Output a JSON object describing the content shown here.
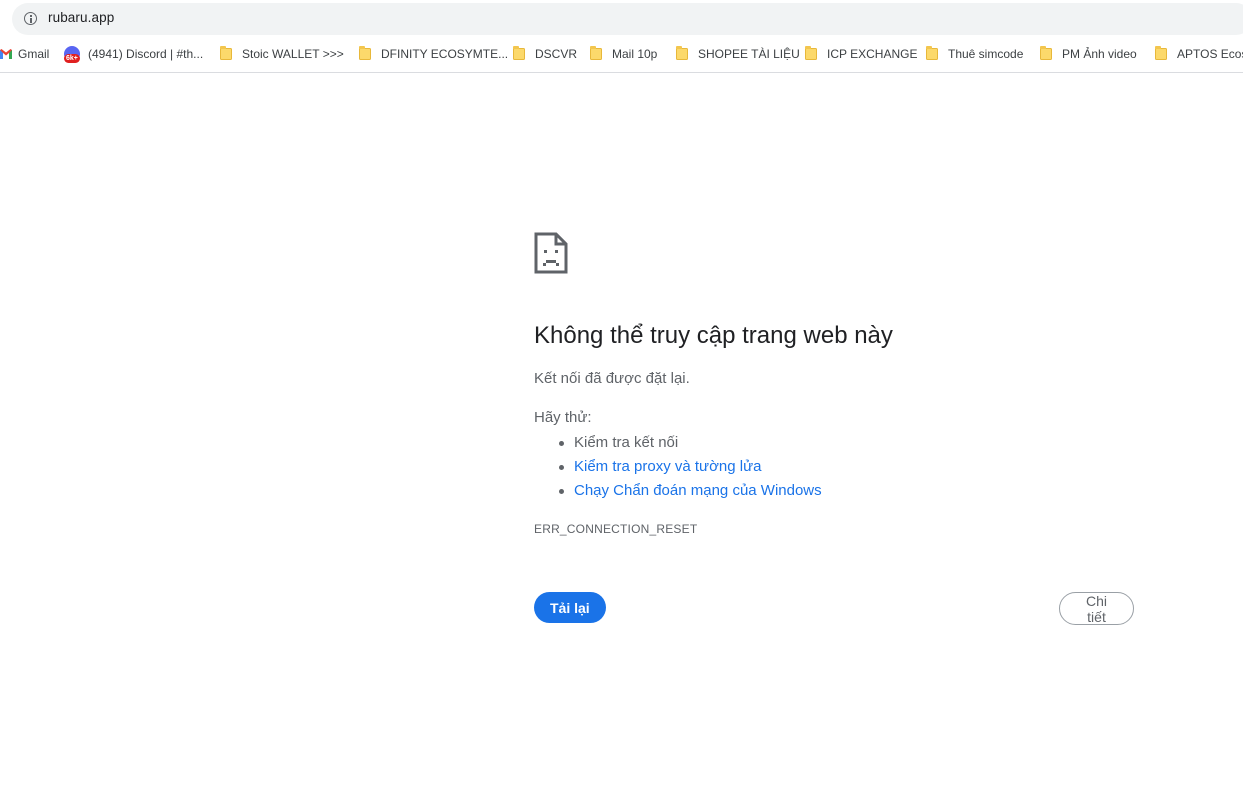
{
  "browser": {
    "url": "rubaru.app",
    "bookmarks": [
      {
        "label": "Gmail",
        "icon": "gmail-icon"
      },
      {
        "label": "(4941) Discord | #th...",
        "icon": "discord-icon",
        "badge": "6k+"
      },
      {
        "label": "Stoic WALLET >>>",
        "icon": "folder-icon"
      },
      {
        "label": "DFINITY ECOSYMTE...",
        "icon": "folder-icon"
      },
      {
        "label": "DSCVR",
        "icon": "folder-icon"
      },
      {
        "label": "Mail 10p",
        "icon": "folder-icon"
      },
      {
        "label": "SHOPEE TÀI LIỆU",
        "icon": "folder-icon"
      },
      {
        "label": "ICP EXCHANGE",
        "icon": "folder-icon"
      },
      {
        "label": "Thuê simcode",
        "icon": "folder-icon"
      },
      {
        "label": "PM Ảnh video",
        "icon": "folder-icon"
      },
      {
        "label": "APTOS Ecosy",
        "icon": "folder-icon"
      }
    ]
  },
  "error_page": {
    "icon": "sad-page-icon",
    "heading": "Không thể truy cập trang web này",
    "subtext": "Kết nối đã được đặt lại.",
    "try_label": "Hãy thử:",
    "suggestions": [
      {
        "text": "Kiểm tra kết nối",
        "link": false
      },
      {
        "text": "Kiểm tra proxy và tường lửa",
        "link": true
      },
      {
        "text": "Chạy Chẩn đoán mạng của Windows",
        "link": true
      }
    ],
    "error_code": "ERR_CONNECTION_RESET",
    "reload_label": "Tải lại",
    "details_label": "Chi tiết"
  },
  "colors": {
    "accent": "#1a73e8",
    "text_primary": "#202124",
    "text_secondary": "#5f6368"
  }
}
